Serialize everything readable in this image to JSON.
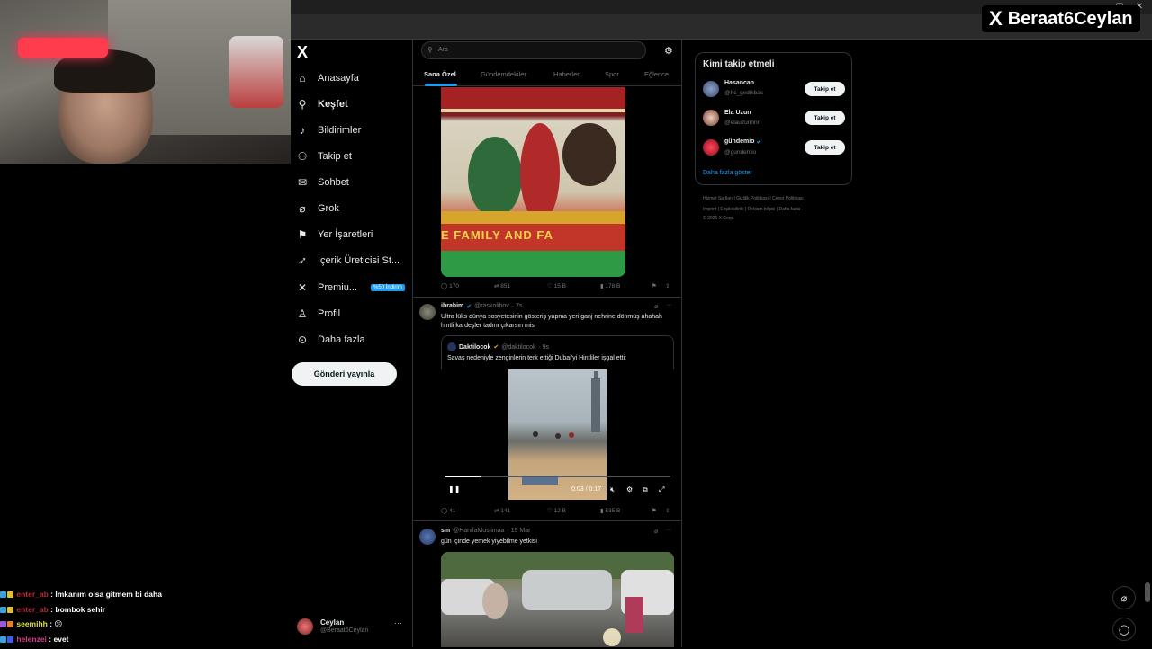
{
  "browser": {
    "window_controls": [
      "–",
      "▢",
      "✕"
    ]
  },
  "brand": {
    "logo": "X",
    "handle": "Beraat6Ceylan"
  },
  "nav": {
    "logo": "X",
    "items": [
      {
        "label": "Anasayfa",
        "icon": "home-icon",
        "glyph": "⌂"
      },
      {
        "label": "Keşfet",
        "icon": "search-icon",
        "glyph": "⚲"
      },
      {
        "label": "Bildirimler",
        "icon": "bell-icon",
        "glyph": "♪"
      },
      {
        "label": "Takip et",
        "icon": "add-person-icon",
        "glyph": "⚇"
      },
      {
        "label": "Sohbet",
        "icon": "mail-icon",
        "glyph": "✉"
      },
      {
        "label": "Grok",
        "icon": "grok-icon",
        "glyph": "⌀"
      },
      {
        "label": "Yer İşaretleri",
        "icon": "bookmark-icon",
        "glyph": "⚑"
      },
      {
        "label": "İçerik Üreticisi St...",
        "icon": "rocket-icon",
        "glyph": "➶"
      },
      {
        "label": "Premiu...",
        "icon": "x-premium-icon",
        "glyph": "✕",
        "badge": "%50 İndirim"
      },
      {
        "label": "Profil",
        "icon": "profile-icon",
        "glyph": "♙"
      },
      {
        "label": "Daha fazla",
        "icon": "more-circle-icon",
        "glyph": "⊙"
      }
    ],
    "post_button": "Gönderi yayınla",
    "profile": {
      "name": "Ceylan",
      "handle": "@Beraat6Ceylan",
      "more": "···"
    }
  },
  "main": {
    "search_placeholder": "Ara",
    "tabs": [
      "Sana Özel",
      "Gündemdekiler",
      "Haberler",
      "Spor",
      "Eğlence"
    ],
    "active_tab": "Sana Özel",
    "post1": {
      "banner_text": "E FAMILY AND FA",
      "stats": {
        "replies": "170",
        "reposts": "851",
        "likes": "15 B",
        "views": "178 B"
      }
    },
    "post2": {
      "name": "ibrahim",
      "handle": "@raskolibov",
      "time": "· 7s",
      "text": "Ultra lüks dünya sosyetesinin gösteriş yapma yeri ganj nehrine dönmüş ahahah hintli kardeşler tadını çıkarsın mis",
      "quote": {
        "name": "Daktilocok",
        "handle": "@daktilocok",
        "time": "· 9s",
        "text": "Savaş nedeniyle zenginlerin terk ettiği Dubai'yi Hintliler işgal etti:",
        "video_time": "0:03 / 0:17"
      },
      "stats": {
        "replies": "41",
        "reposts": "141",
        "likes": "12 B",
        "views": "535 B"
      }
    },
    "post3": {
      "name": "sm",
      "handle": "@HanifaMuslimaa",
      "time": "· 19 Mar",
      "text": "gün içinde yemek yiyebilme yetkisi"
    }
  },
  "right": {
    "who_to_follow_title": "Kimi takip etmeli",
    "suggestions": [
      {
        "name": "Hasancan",
        "handle": "@hc_gedikbas",
        "button": "Takip et"
      },
      {
        "name": "Ela Uzun",
        "handle": "@elauzunnnn",
        "button": "Takip et"
      },
      {
        "name": "gündemio",
        "handle": "@gundemio",
        "button": "Takip et"
      }
    ],
    "show_more": "Daha fazla göster",
    "footer_line1": "Hizmet Şartları  |  Gizlilik Politikası  |  Çerez Politikası  |",
    "footer_line2": "Imprint  |  Erişilebilirlik  |  Reklam bilgisi  |  Daha fazla ···",
    "footer_line3": "© 2026 X Corp."
  },
  "stream_chat": [
    {
      "user": "enter_ab",
      "message": "İmkanım olsa gitmem bi daha",
      "color": "#b22a3a"
    },
    {
      "user": "enter_ab",
      "message": "bombok sehir",
      "color": "#b22a3a"
    },
    {
      "user": "seemihh",
      "message": "😕",
      "color": "#e0e040"
    },
    {
      "user": "helenzei",
      "message": "evet",
      "color": "#d63a8a"
    }
  ]
}
